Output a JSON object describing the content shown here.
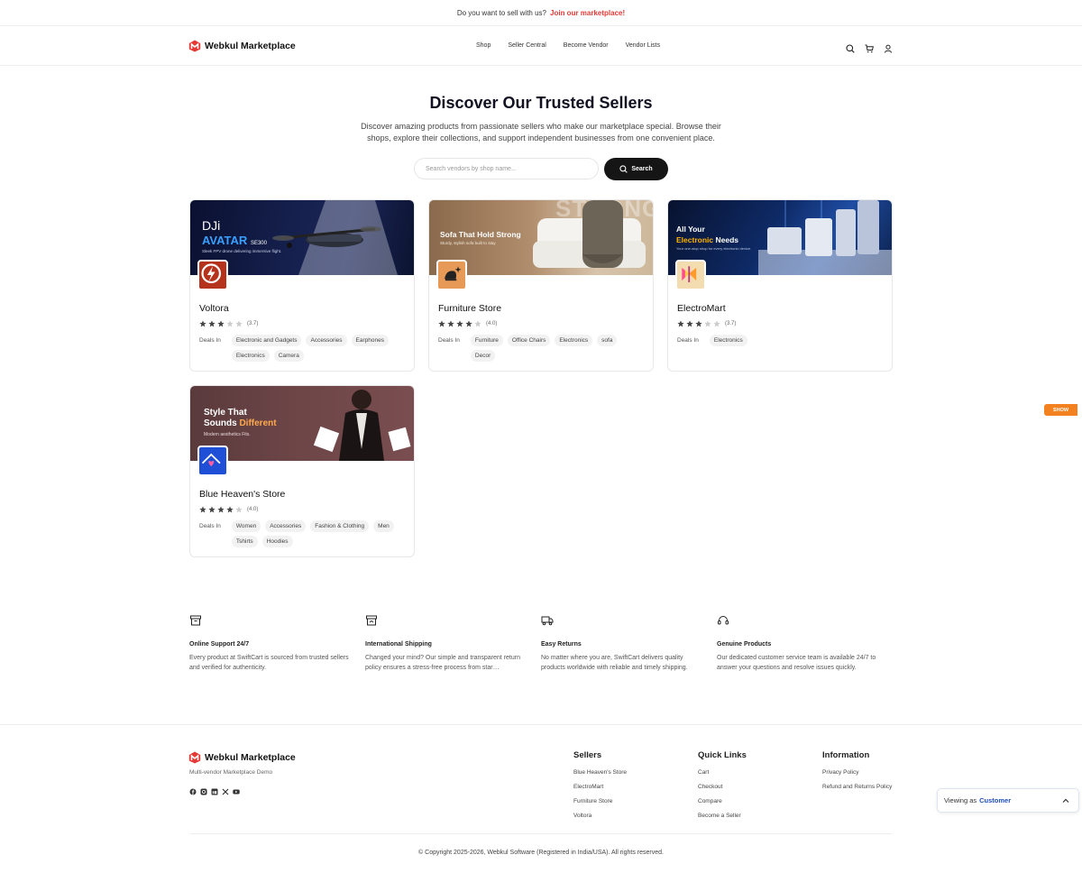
{
  "topbar": {
    "text": "Do you want to sell with us?",
    "link": "Join our marketplace!"
  },
  "nav": {
    "brand": "Webkul Marketplace",
    "links": [
      "Shop",
      "Seller Central",
      "Become Vendor",
      "Vendor Lists"
    ],
    "icons": [
      "search-icon",
      "cart-icon",
      "user-icon"
    ]
  },
  "hero": {
    "title": "Discover Our Trusted Sellers",
    "subtitle": "Discover amazing products from passionate sellers who make our marketplace special. Browse their shops, explore their collections, and support independent businesses from one convenient place.",
    "search_placeholder": "Search vendors by shop name...",
    "search_button": "Search"
  },
  "vendors": [
    {
      "name": "Voltora",
      "rating": 3.7,
      "rating_text": "(3.7)",
      "deals_label": "Deals In",
      "tags": [
        "Electronic and Gadgets",
        "Accessories",
        "Earphones",
        "Electronics",
        "Camera"
      ],
      "banner": {
        "line1": "DJi",
        "line2": "AVATAR",
        "line3": "SE300",
        "sub": "Sleek FPV drone delivering immersive flight."
      }
    },
    {
      "name": "Furniture Store",
      "rating": 4.0,
      "rating_text": "(4.0)",
      "deals_label": "Deals In",
      "tags": [
        "Furniture",
        "Office Chairs",
        "Electronics",
        "sofa",
        "Decor"
      ],
      "banner": {
        "line1": "Sofa That Hold Strong",
        "sub": "Sturdy, stylish sofa built to stay.",
        "bg_text": "STRONG"
      }
    },
    {
      "name": "ElectroMart",
      "rating": 3.7,
      "rating_text": "(3.7)",
      "deals_label": "Deals In",
      "tags": [
        "Electronics"
      ],
      "banner": {
        "line1": "All Your",
        "line2a": "Electronic",
        "line2b": " Needs",
        "sub": "Your one-stop shop for every electronic device."
      }
    },
    {
      "name": "Blue Heaven's Store",
      "rating": 4.0,
      "rating_text": "(4.0)",
      "deals_label": "Deals In",
      "tags": [
        "Women",
        "Accessories",
        "Fashion & Clothing",
        "Men",
        "Tshirts",
        "Hoodies"
      ],
      "banner": {
        "line1": "Style That",
        "line2a": "Sounds ",
        "line2b": "Different",
        "sub": "Modern aesthetics Fits."
      }
    }
  ],
  "features": [
    {
      "icon": "archive-box-icon",
      "title": "Online Support 24/7",
      "text": "Every product at SwiftCart is sourced from trusted sellers and verified for authenticity."
    },
    {
      "icon": "box-return-icon",
      "title": "International Shipping",
      "text": "Changed your mind? Our simple and transparent return policy ensures a stress-free process from star…"
    },
    {
      "icon": "truck-icon",
      "title": "Easy Returns",
      "text": "No matter where you are, SwiftCart delivers quality products worldwide with reliable and timely shipping."
    },
    {
      "icon": "headset-icon",
      "title": "Genuine Products",
      "text": "Our dedicated customer service team is available 24/7 to answer your questions and resolve issues quickly."
    }
  ],
  "footer": {
    "brand": "Webkul Marketplace",
    "tagline": "Multi-vendor Marketplace Demo",
    "social": [
      "facebook-icon",
      "instagram-icon",
      "linkedin-icon",
      "x-icon",
      "youtube-icon"
    ],
    "columns": [
      {
        "title": "Sellers",
        "items": [
          "Blue Heaven's Store",
          "ElectroMart",
          "Furniture Store",
          "Voltora"
        ]
      },
      {
        "title": "Quick Links",
        "items": [
          "Cart",
          "Checkout",
          "Compare",
          "Become a Seller"
        ]
      },
      {
        "title": "Information",
        "items": [
          "Privacy Policy",
          "Refund and Returns Policy"
        ]
      }
    ],
    "copyright": "© Copyright 2025-2026, Webkul Software (Registered in India/USA). All rights reserved."
  },
  "widgets": {
    "show_tab": "SHOW",
    "viewing_prefix": "Viewing as",
    "viewing_role": "Customer"
  },
  "colors": {
    "accent": "#e53935",
    "dark_button": "#151515",
    "show_tab": "#f4811f",
    "role_link": "#1e4db7",
    "star_filled": "#444444",
    "star_empty": "#cccccc"
  }
}
